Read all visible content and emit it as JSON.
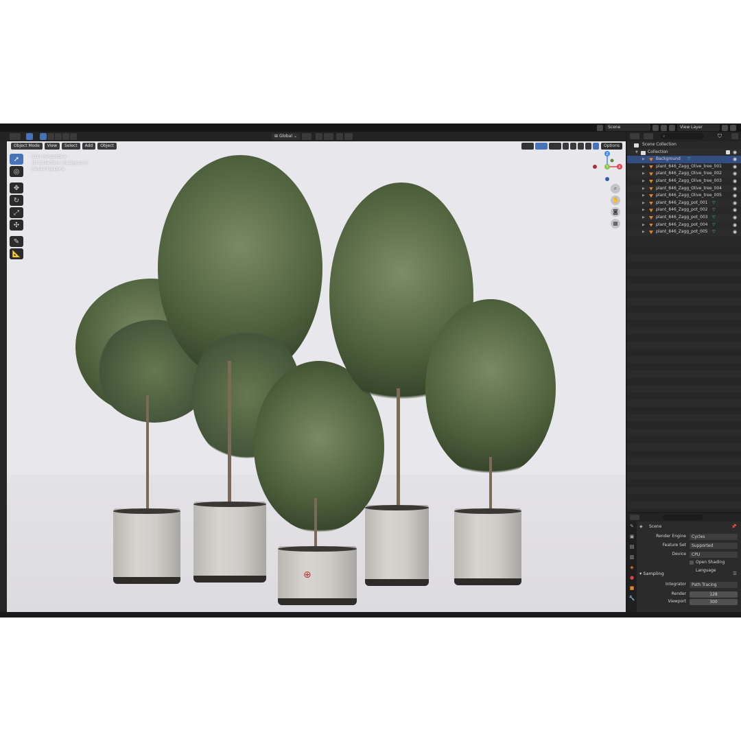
{
  "topbar": {
    "scene_label": "Scene",
    "view_layer_label": "View Layer"
  },
  "viewport_header": {
    "mode": "Object Mode",
    "menus": [
      "View",
      "Select",
      "Add",
      "Object"
    ],
    "transform_orientation": "Global",
    "options": "Options"
  },
  "viewport": {
    "info_lines": [
      "User Perspective",
      "(1) Collection | Background",
      "Rendering Done"
    ],
    "gizmo": {
      "x": "X",
      "y": "Y",
      "z": "Z"
    }
  },
  "outliner": {
    "search_placeholder": "",
    "rows": [
      {
        "label": "Scene Collection",
        "kind": "root"
      },
      {
        "label": "Collection",
        "kind": "collection"
      },
      {
        "label": "Background",
        "kind": "object",
        "selected": true,
        "modifier": true
      },
      {
        "label": "plant_846_Zagg_Olive_tree_001",
        "kind": "object"
      },
      {
        "label": "plant_846_Zagg_Olive_tree_002",
        "kind": "object"
      },
      {
        "label": "plant_846_Zagg_Olive_tree_003",
        "kind": "object"
      },
      {
        "label": "plant_846_Zagg_Olive_tree_004",
        "kind": "object"
      },
      {
        "label": "plant_846_Zagg_Olive_tree_005",
        "kind": "object"
      },
      {
        "label": "plant_846_Zagg_pot_001",
        "kind": "object",
        "modifier": true
      },
      {
        "label": "plant_846_Zagg_pot_002",
        "kind": "object",
        "modifier": true
      },
      {
        "label": "plant_846_Zagg_pot_003",
        "kind": "object",
        "modifier": true
      },
      {
        "label": "plant_846_Zagg_pot_004",
        "kind": "object",
        "modifier": true
      },
      {
        "label": "plant_846_Zagg_pot_005",
        "kind": "object",
        "modifier": true
      }
    ]
  },
  "properties": {
    "context": "Scene",
    "render_engine_label": "Render Engine",
    "render_engine": "Cycles",
    "feature_set_label": "Feature Set",
    "feature_set": "Supported",
    "device_label": "Device",
    "device": "CPU",
    "osl_label": "Open Shading Language",
    "sampling_section": "Sampling",
    "integrator_label": "Integrator",
    "integrator": "Path Tracing",
    "render_label": "Render",
    "render_samples": "128",
    "viewport_label": "Viewport",
    "viewport_samples": "300"
  },
  "colors": {
    "selection": "#334d80",
    "active_tool": "#4773b8",
    "object_icon": "#e0872b",
    "modifier_icon": "#3cc6a0",
    "axis_x": "#e3424f",
    "axis_y": "#8bc34a",
    "axis_z": "#3c8ce7"
  }
}
